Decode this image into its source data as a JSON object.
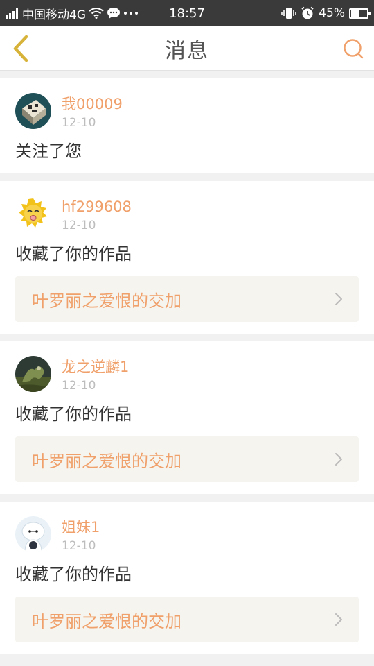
{
  "status_bar": {
    "carrier": "中国移动4G",
    "time": "18:57",
    "battery": "45%",
    "battery_level": 0.45,
    "icons": [
      "signal-icon",
      "wifi-icon",
      "chat-icon",
      "more-icon",
      "vibrate-icon",
      "alarm-icon",
      "battery-icon"
    ]
  },
  "header": {
    "title": "消息",
    "back_icon": "chevron-left-icon",
    "search_icon": "search-icon"
  },
  "colors": {
    "accent": "#f0a06a",
    "back_icon": "#d8b33a",
    "card_bg": "#ffffff",
    "page_bg": "#f1f1f1",
    "work_bg": "#f5f4ef"
  },
  "messages": [
    {
      "username": "我00009",
      "date": "12-10",
      "action": "关注了您"
    },
    {
      "username": "hf299608",
      "date": "12-10",
      "action": "收藏了你的作品",
      "work_title": "叶罗丽之爱恨的交加"
    },
    {
      "username": "龙之逆麟1",
      "date": "12-10",
      "action": "收藏了你的作品",
      "work_title": "叶罗丽之爱恨的交加"
    },
    {
      "username": "姐妹1",
      "date": "12-10",
      "action": "收藏了你的作品",
      "work_title": "叶罗丽之爱恨的交加"
    }
  ]
}
